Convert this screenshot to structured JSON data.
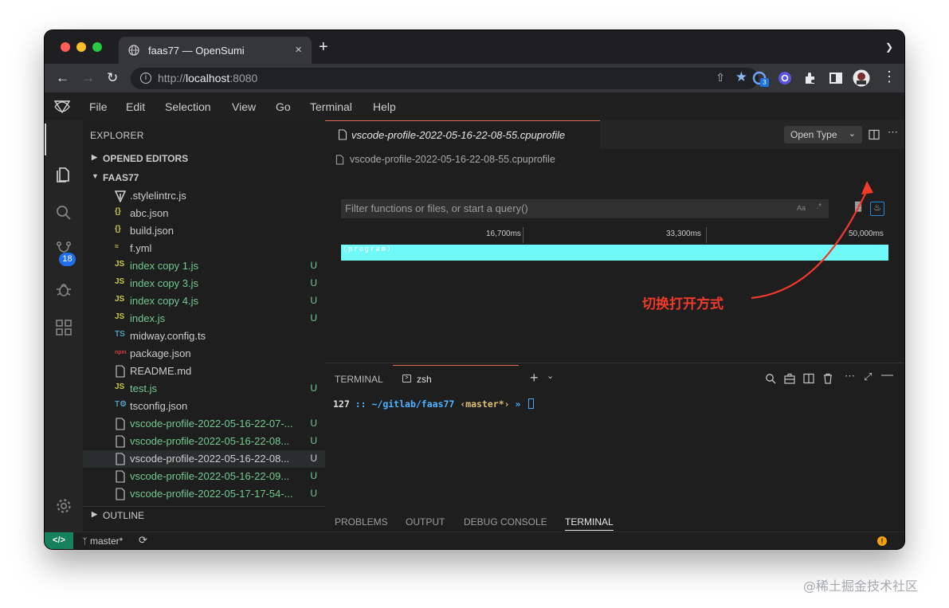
{
  "browser": {
    "tab_title": "faas77 — OpenSumi",
    "tab_close": "×",
    "new_tab": "+",
    "url_scheme": "http://",
    "url_host": "localhost",
    "url_port": ":8080",
    "extension_badge": "3"
  },
  "menubar": {
    "items": [
      "File",
      "Edit",
      "Selection",
      "View",
      "Go",
      "Terminal",
      "Help"
    ]
  },
  "activity": {
    "scm_badge": "18"
  },
  "explorer": {
    "title": "EXPLORER",
    "opened_editors": "OPENED EDITORS",
    "folder": "FAAS77",
    "outline": "OUTLINE",
    "files": [
      {
        "name": ".stylelintrc.js",
        "icon": "stylelint-icon",
        "status": ""
      },
      {
        "name": "abc.json",
        "icon": "json-icon",
        "status": ""
      },
      {
        "name": "build.json",
        "icon": "json-icon",
        "status": ""
      },
      {
        "name": "f.yml",
        "icon": "yaml-icon",
        "status": ""
      },
      {
        "name": "index copy 1.js",
        "icon": "js-icon",
        "status": "U"
      },
      {
        "name": "index copy 3.js",
        "icon": "js-icon",
        "status": "U"
      },
      {
        "name": "index copy 4.js",
        "icon": "js-icon",
        "status": "U"
      },
      {
        "name": "index.js",
        "icon": "js-icon",
        "status": "U"
      },
      {
        "name": "midway.config.ts",
        "icon": "ts-icon",
        "status": ""
      },
      {
        "name": "package.json",
        "icon": "npm-icon",
        "status": ""
      },
      {
        "name": "README.md",
        "icon": "file-icon",
        "status": ""
      },
      {
        "name": "test.js",
        "icon": "js-icon",
        "status": "U"
      },
      {
        "name": "tsconfig.json",
        "icon": "tsconfig-icon",
        "status": ""
      },
      {
        "name": "vscode-profile-2022-05-16-22-07-...",
        "icon": "file-icon",
        "status": "U"
      },
      {
        "name": "vscode-profile-2022-05-16-22-08...",
        "icon": "file-icon",
        "status": "U"
      },
      {
        "name": "vscode-profile-2022-05-16-22-08...",
        "icon": "file-icon",
        "status": "U"
      },
      {
        "name": "vscode-profile-2022-05-16-22-09...",
        "icon": "file-icon",
        "status": "U"
      },
      {
        "name": "vscode-profile-2022-05-17-17-54-...",
        "icon": "file-icon",
        "status": "U"
      }
    ]
  },
  "editor": {
    "tab_title": "vscode-profile-2022-05-16-22-08-55.cpuprofile",
    "open_type_label": "Open Type",
    "breadcrumb": "vscode-profile-2022-05-16-22-08-55.cpuprofile",
    "filter_placeholder": "Filter functions or files, or start a query()",
    "filter_case": "Aa",
    "filter_regex": ".*",
    "timeline_ticks": [
      "16,700ms",
      "33,300ms",
      "50,000ms"
    ],
    "flame_label": "(program)",
    "flame_color": "#6ff9f9",
    "annotation": "切换打开方式",
    "annotation_color": "#f23a2a"
  },
  "panel": {
    "label": "TERMINAL",
    "terminal_tab": "zsh",
    "prompt_code": "127",
    "prompt_sep": " :: ",
    "prompt_path": "~/gitlab/faas77",
    "prompt_branch": " ‹master*›",
    "prompt_end": " » ",
    "bottom_tabs": [
      "PROBLEMS",
      "OUTPUT",
      "DEBUG CONSOLE",
      "TERMINAL"
    ]
  },
  "statusbar": {
    "remote": "</>",
    "branch": "master*"
  },
  "watermark": "@稀土掘金技术社区"
}
